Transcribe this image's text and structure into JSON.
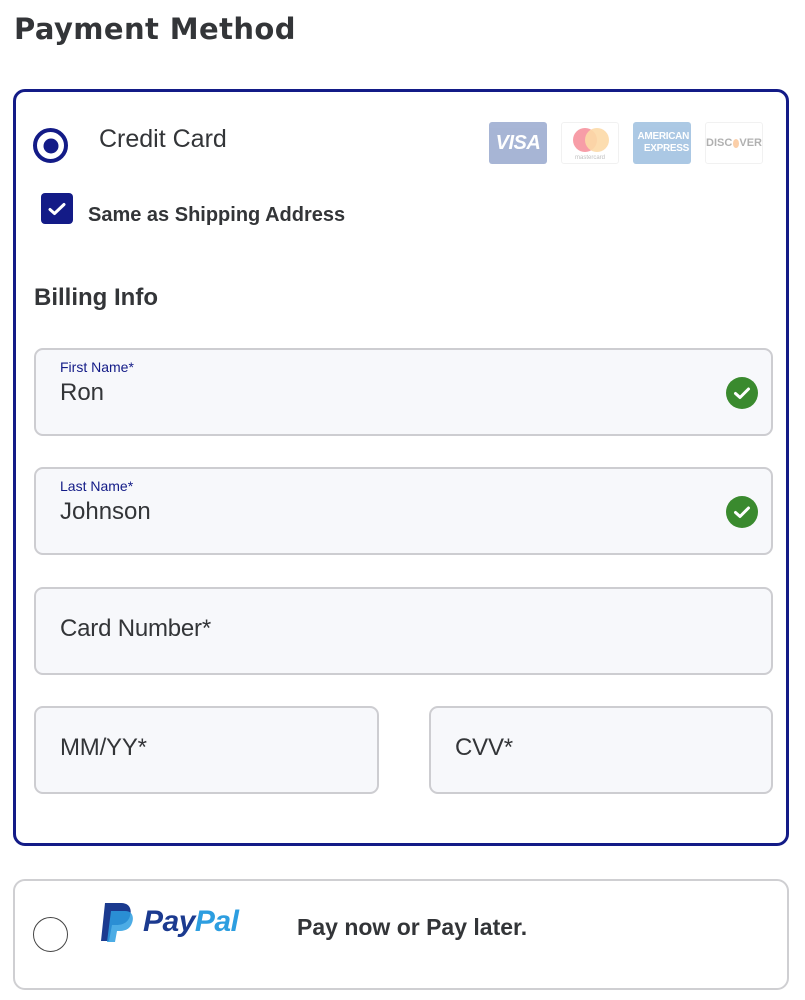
{
  "page": {
    "title": "Payment Method"
  },
  "credit_card": {
    "label": "Credit Card",
    "selected": true,
    "card_logos": [
      {
        "name": "visa",
        "text": "VISA"
      },
      {
        "name": "mastercard",
        "text": "mastercard"
      },
      {
        "name": "american-express",
        "line1": "AMERICAN",
        "line2": "EXPRESS"
      },
      {
        "name": "discover",
        "pre": "DISC",
        "post": "VER"
      }
    ],
    "same_as_shipping": {
      "label": "Same as Shipping Address",
      "checked": true
    },
    "billing_info": {
      "title": "Billing Info",
      "fields": {
        "first_name": {
          "label": "First Name*",
          "value": "Ron",
          "valid": true
        },
        "last_name": {
          "label": "Last Name*",
          "value": "Johnson",
          "valid": true
        },
        "card_number": {
          "placeholder": "Card Number*",
          "value": ""
        },
        "expiry": {
          "placeholder": "MM/YY*",
          "value": ""
        },
        "cvv": {
          "placeholder": "CVV*",
          "value": ""
        }
      }
    }
  },
  "paypal": {
    "logo_pay": "Pay",
    "logo_pal": "Pal",
    "description": "Pay now or Pay later.",
    "selected": false
  },
  "colors": {
    "accent": "#131b87",
    "success": "#3a8a2e",
    "text": "#333538",
    "field_bg": "#f7f8fb",
    "field_border": "#cdcdd1",
    "paypal_dark": "#1b3a8f",
    "paypal_light": "#2d9ee0"
  },
  "icons": {
    "radio_selected": "radio-selected-icon",
    "radio_unselected": "radio-unselected-icon",
    "checkbox_checked": "checkmark-icon",
    "field_valid": "check-circle-icon",
    "paypal": "paypal-logo"
  }
}
